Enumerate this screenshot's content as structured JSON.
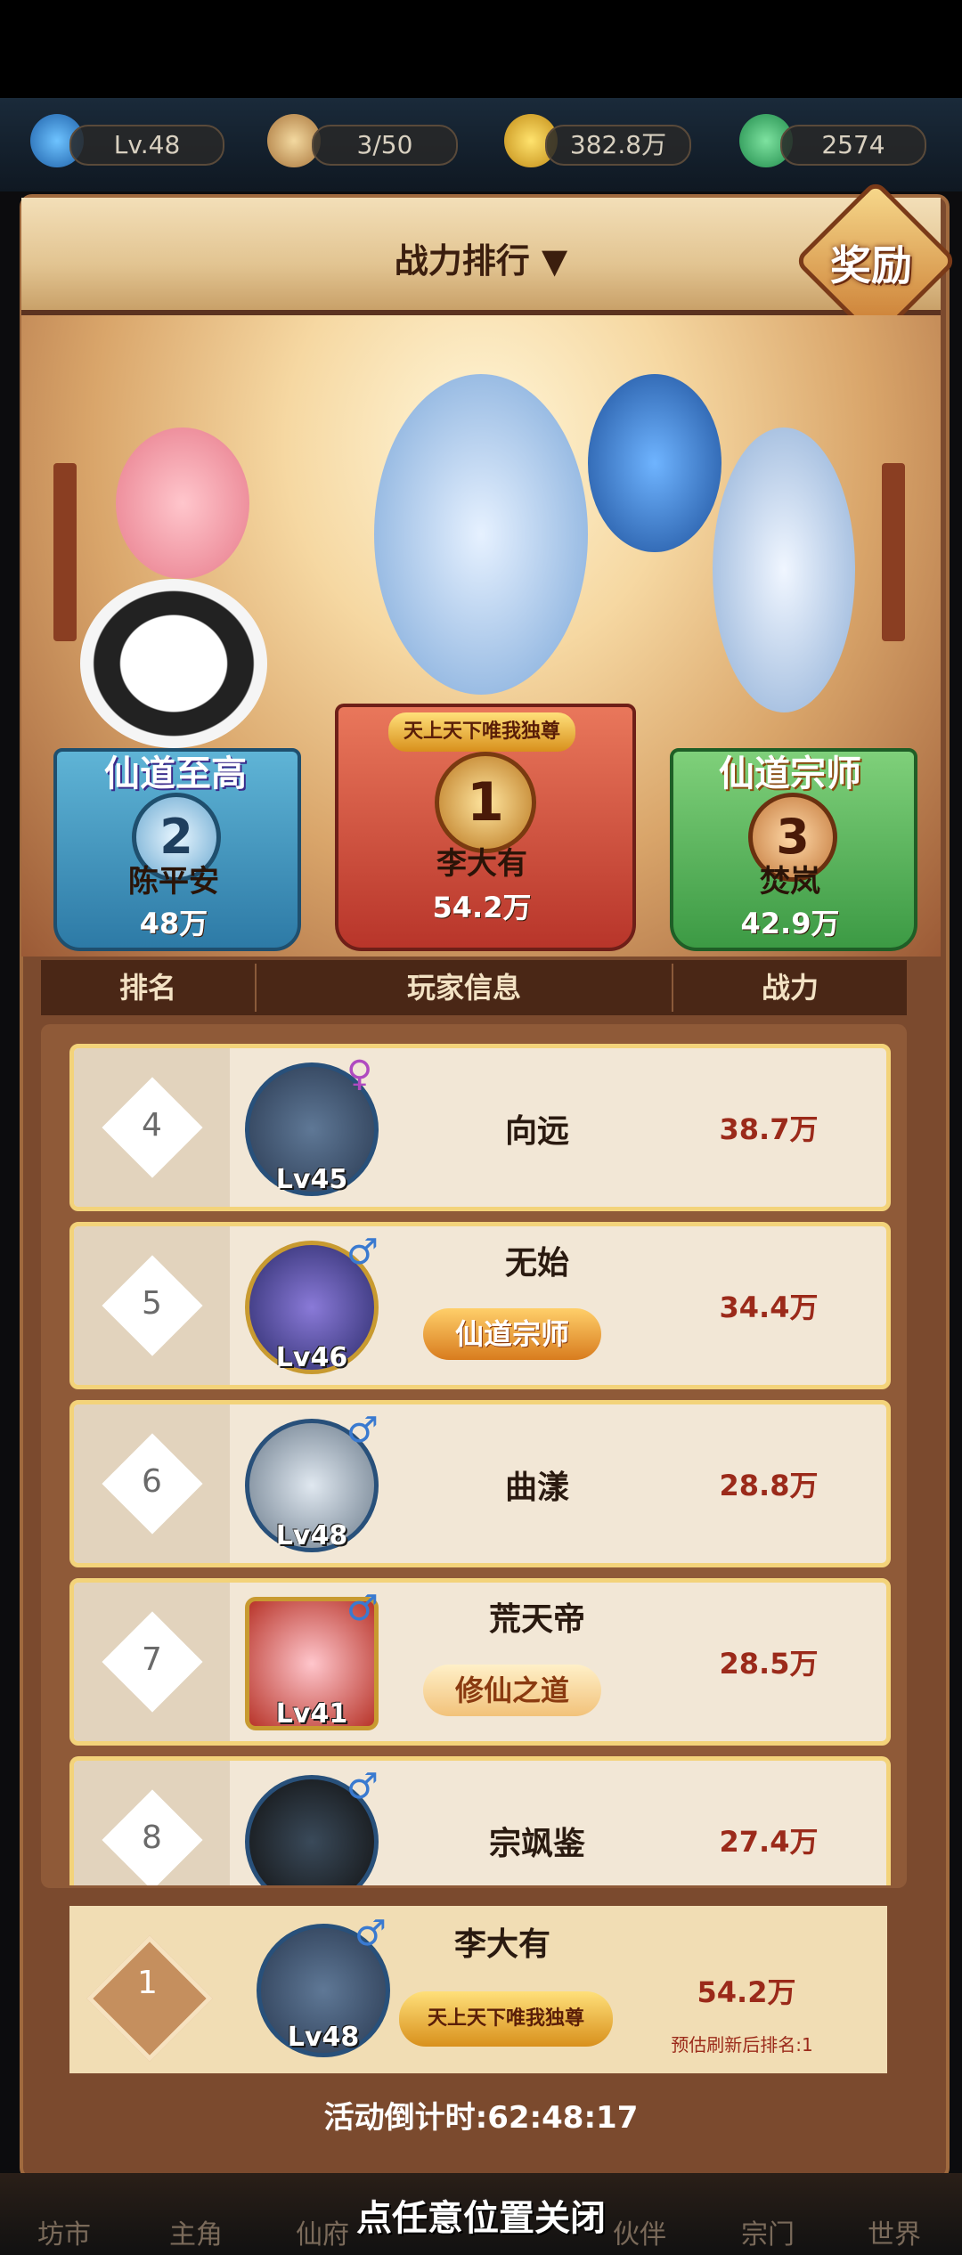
{
  "status_bar": {
    "level": "Lv.48",
    "stamina": "3/50",
    "coins": "382.8万",
    "jade": "2574"
  },
  "header": {
    "title": "战力排行 ▼",
    "reward_button": "奖励"
  },
  "podium": {
    "first": {
      "rank": "1",
      "title_banner": "天上天下唯我独尊",
      "name": "李大有",
      "power": "54.2万"
    },
    "second": {
      "rank": "2",
      "title_banner": "仙道至高",
      "name": "陈平安",
      "power": "48万"
    },
    "third": {
      "rank": "3",
      "title_banner": "仙道宗师",
      "name": "焚岚",
      "power": "42.9万"
    }
  },
  "table": {
    "col_rank": "排名",
    "col_player": "玩家信息",
    "col_power": "战力"
  },
  "rows": [
    {
      "rank": "4",
      "level": "Lv45",
      "gender": "♀",
      "name": "向远",
      "title": "",
      "power": "38.7万"
    },
    {
      "rank": "5",
      "level": "Lv46",
      "gender": "♂",
      "name": "无始",
      "title": "仙道宗师",
      "power": "34.4万"
    },
    {
      "rank": "6",
      "level": "Lv48",
      "gender": "♂",
      "name": "曲漾",
      "title": "",
      "power": "28.8万"
    },
    {
      "rank": "7",
      "level": "Lv41",
      "gender": "♂",
      "name": "荒天帝",
      "title": "修仙之道",
      "power": "28.5万"
    },
    {
      "rank": "8",
      "level": "",
      "gender": "♂",
      "name": "宗飒鉴",
      "title": "",
      "power": "27.4万"
    }
  ],
  "my_entry": {
    "rank": "1",
    "level": "Lv48",
    "gender": "♂",
    "name": "李大有",
    "title": "天上天下唯我独尊",
    "power": "54.2万",
    "estimate": "预估刷新后排名:1"
  },
  "countdown": "活动倒计时:62:48:17",
  "bottom_nav": [
    "坊市",
    "主角",
    "仙府",
    "伙伴",
    "宗门",
    "世界"
  ],
  "close_tip": "点任意位置关闭",
  "colors": {
    "male": "#3a7ad0",
    "female": "#b04ac0",
    "power_red": "#9b2a1a"
  }
}
